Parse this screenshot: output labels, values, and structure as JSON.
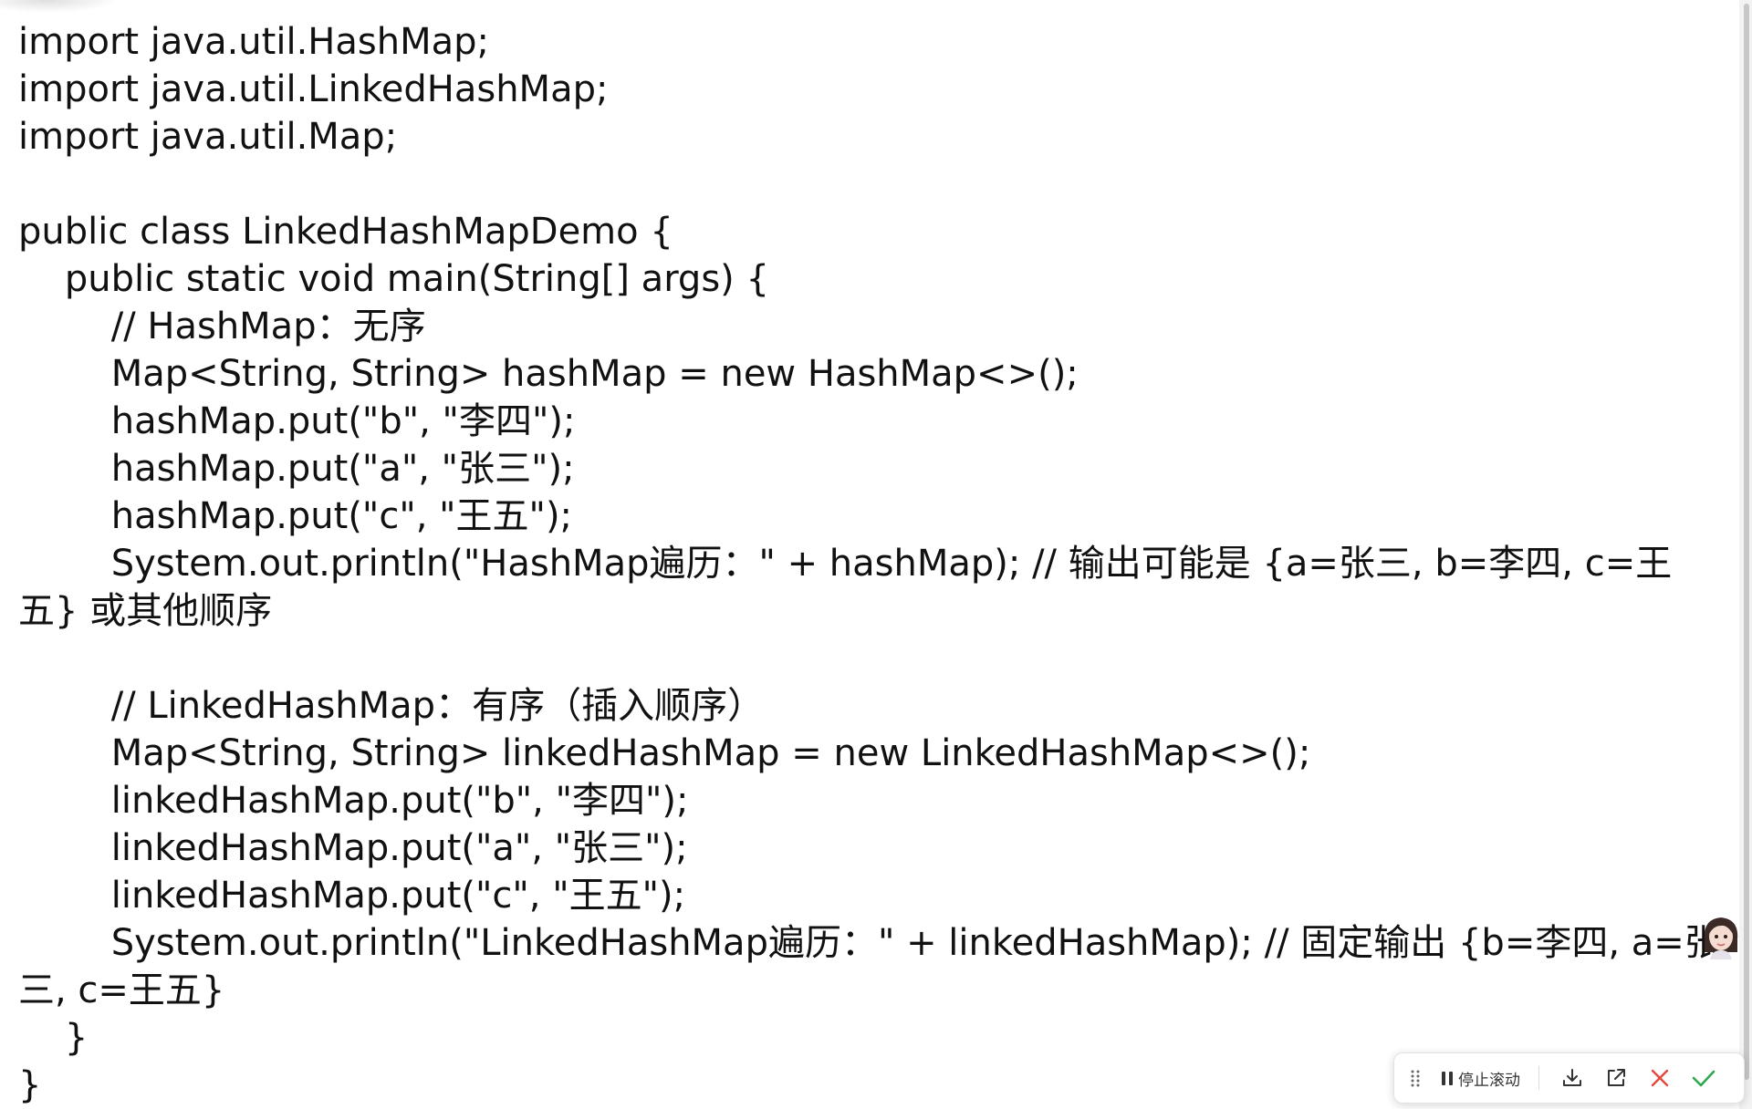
{
  "code": {
    "lines": [
      "import java.util.HashMap;",
      "import java.util.LinkedHashMap;",
      "import java.util.Map;",
      "",
      "public class LinkedHashMapDemo {",
      "    public static void main(String[] args) {",
      "        // HashMap：无序",
      "        Map<String, String> hashMap = new HashMap<>();",
      "        hashMap.put(\"b\", \"李四\");",
      "        hashMap.put(\"a\", \"张三\");",
      "        hashMap.put(\"c\", \"王五\");",
      "        System.out.println(\"HashMap遍历：\" + hashMap); // 输出可能是 {a=张三, b=李四, c=王五} 或其他顺序",
      "",
      "        // LinkedHashMap：有序（插入顺序）",
      "        Map<String, String> linkedHashMap = new LinkedHashMap<>();",
      "        linkedHashMap.put(\"b\", \"李四\");",
      "        linkedHashMap.put(\"a\", \"张三\");",
      "        linkedHashMap.put(\"c\", \"王五\");",
      "        System.out.println(\"LinkedHashMap遍历：\" + linkedHashMap); // 固定输出 {b=李四, a=张三, c=王五}",
      "    }",
      "}"
    ]
  },
  "toolbar": {
    "drag_icon": "drag-handle-icon",
    "pause_icon": "pause-icon",
    "stop_scroll_label": "停止滚动",
    "download_icon": "download-icon",
    "open_external_icon": "open-external-icon",
    "close_icon": "close-icon",
    "confirm_icon": "checkmark-icon"
  },
  "colors": {
    "text": "#111111",
    "close": "#e5483f",
    "confirm": "#2fa84f"
  }
}
